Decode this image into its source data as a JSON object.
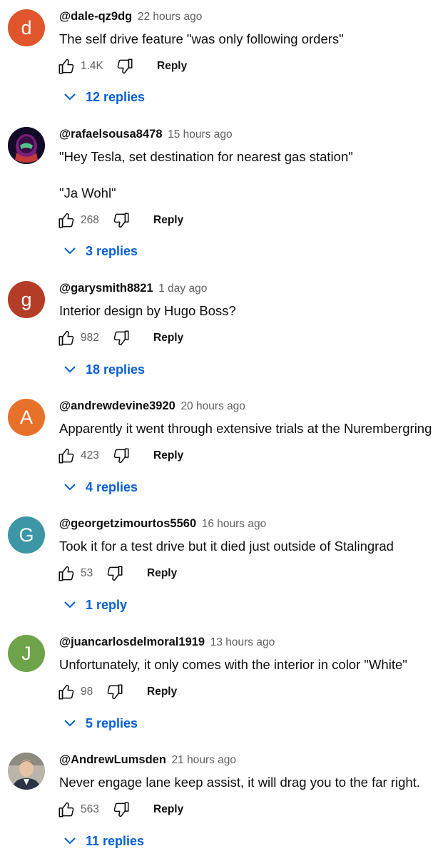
{
  "colors": {
    "link": "#065fd4",
    "secondary_text": "#606060"
  },
  "icons": {
    "like": "thumbs-up-icon",
    "dislike": "thumbs-down-icon",
    "expand": "chevron-down-icon"
  },
  "comments": [
    {
      "avatar_letter": "d",
      "avatar_color": "#e0552c",
      "author": "@dale-qz9dg",
      "time": "22 hours ago",
      "lines": [
        "The self drive feature \"was only following orders\""
      ],
      "likes": "1.4K",
      "reply_label": "Reply",
      "replies": "12 replies"
    },
    {
      "avatar_letter": "",
      "avatar_color": "#1a1030",
      "author": "@rafaelsousa8478",
      "time": "15 hours ago",
      "lines": [
        "\"Hey Tesla, set destination for nearest gas station\"",
        "\"Ja Wohl\""
      ],
      "likes": "268",
      "reply_label": "Reply",
      "replies": "3 replies"
    },
    {
      "avatar_letter": "g",
      "avatar_color": "#b33d26",
      "author": "@garysmith8821",
      "time": "1 day ago",
      "lines": [
        "Interior design by Hugo Boss?"
      ],
      "likes": "982",
      "reply_label": "Reply",
      "replies": "18 replies"
    },
    {
      "avatar_letter": "A",
      "avatar_color": "#e8712a",
      "author": "@andrewdevine3920",
      "time": "20 hours ago",
      "lines": [
        "Apparently it went through extensive trials at the Nurembergring"
      ],
      "likes": "423",
      "reply_label": "Reply",
      "replies": "4 replies"
    },
    {
      "avatar_letter": "G",
      "avatar_color": "#3c96a6",
      "author": "@georgetzimourtos5560",
      "time": "16 hours ago",
      "lines": [
        "Took it for a test drive but it died just outside of Stalingrad"
      ],
      "likes": "53",
      "reply_label": "Reply",
      "replies": "1 reply"
    },
    {
      "avatar_letter": "J",
      "avatar_color": "#6ea349",
      "author": "@juancarlosdelmoral1919",
      "time": "13 hours ago",
      "lines": [
        "Unfortunately, it only comes with the interior in color \"White\""
      ],
      "likes": "98",
      "reply_label": "Reply",
      "replies": "5 replies"
    },
    {
      "avatar_letter": "",
      "avatar_color": "#c9c4b8",
      "author": "@AndrewLumsden",
      "time": "21 hours ago",
      "lines": [
        "Never engage lane keep assist, it will drag you to the far right."
      ],
      "likes": "563",
      "reply_label": "Reply",
      "replies": "11 replies"
    }
  ]
}
